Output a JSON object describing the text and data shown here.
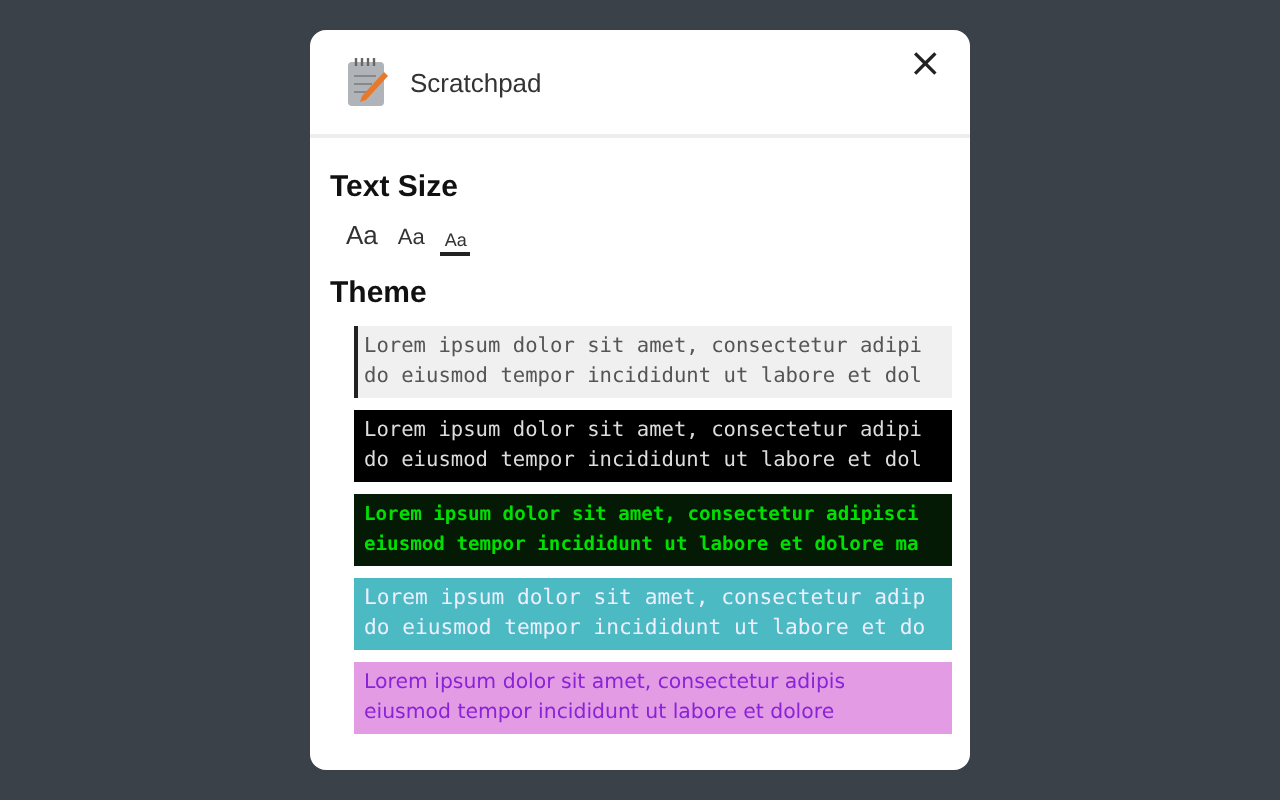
{
  "dialog": {
    "title": "Scratchpad",
    "close": "×"
  },
  "text_size": {
    "heading": "Text Size",
    "options": [
      {
        "label": "Aa",
        "kind": "large",
        "selected": false
      },
      {
        "label": "Aa",
        "kind": "medium",
        "selected": false
      },
      {
        "label": "Aa",
        "kind": "small",
        "selected": true
      }
    ]
  },
  "theme": {
    "heading": "Theme",
    "options": [
      {
        "kind": "light",
        "selected": true,
        "lines": [
          "Lorem ipsum dolor sit amet, consectetur adipi",
          "do eiusmod tempor incididunt ut labore et dol"
        ]
      },
      {
        "kind": "dark",
        "selected": false,
        "lines": [
          "Lorem ipsum dolor sit amet, consectetur adipi",
          "do eiusmod tempor incididunt ut labore et dol"
        ]
      },
      {
        "kind": "terminal",
        "selected": false,
        "lines": [
          "Lorem ipsum dolor sit amet, consectetur adipisci",
          "eiusmod tempor incididunt ut labore et dolore ma"
        ]
      },
      {
        "kind": "teal",
        "selected": false,
        "lines": [
          "Lorem ipsum dolor sit amet, consectetur adip",
          "do eiusmod tempor incididunt ut labore et do"
        ]
      },
      {
        "kind": "pink",
        "selected": false,
        "lines": [
          "Lorem ipsum dolor sit amet, consectetur adipis",
          "eiusmod tempor incididunt ut labore et dolore"
        ]
      }
    ]
  }
}
